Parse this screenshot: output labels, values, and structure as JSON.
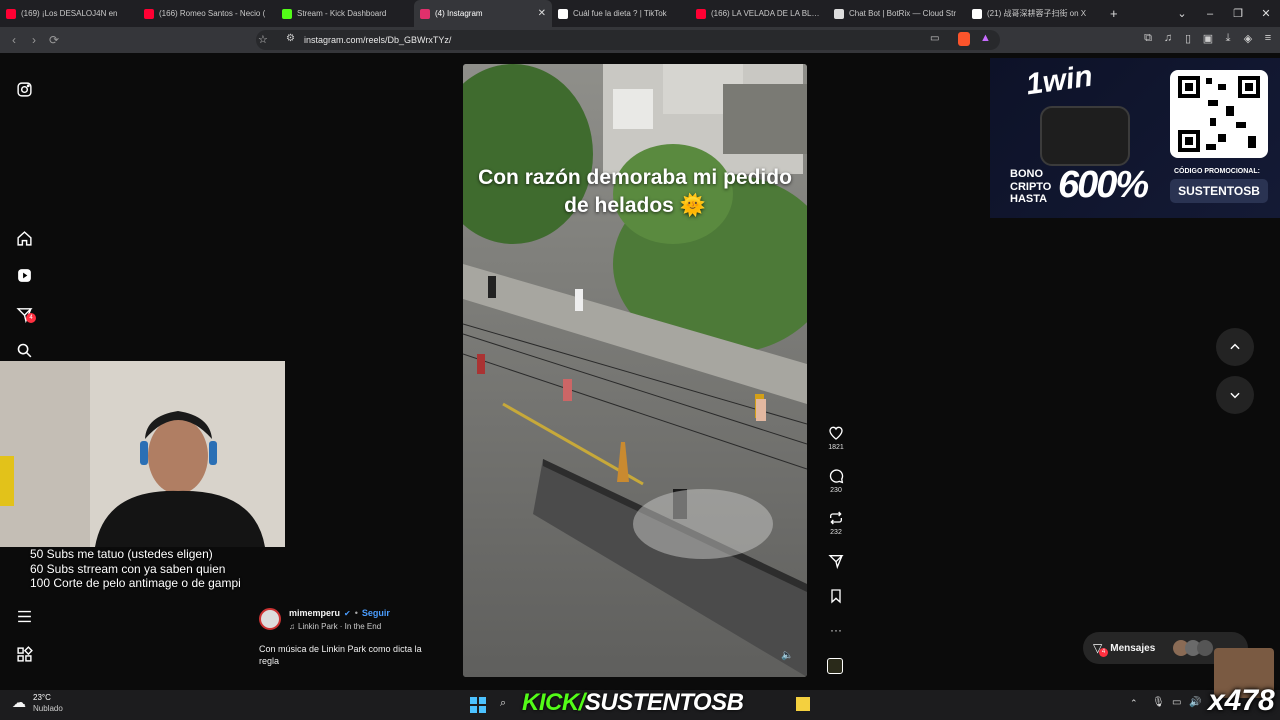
{
  "browser": {
    "tabs": [
      {
        "label": "(169) ¡Los DESALOJ4N en",
        "favicon_color": "#ff0033",
        "active": false
      },
      {
        "label": "(166) Romeo Santos - Necio (",
        "favicon_color": "#ff0033",
        "active": false
      },
      {
        "label": "Stream - Kick Dashboard",
        "favicon_color": "#53fc18",
        "active": false
      },
      {
        "label": "(4) Instagram",
        "favicon_color": "#e1306c",
        "active": true
      },
      {
        "label": "Cuál fue la dieta ? | TikTok",
        "favicon_color": "#ffffff",
        "active": false
      },
      {
        "label": "(166) LA VELADA DE LA BLAC",
        "favicon_color": "#ff0033",
        "active": false
      },
      {
        "label": "Chat Bot | BotRix — Cloud Str",
        "favicon_color": "#dddddd",
        "active": false
      },
      {
        "label": "(21) 战哥深耕蓉子扫街 on X",
        "favicon_color": "#ffffff",
        "active": false
      }
    ],
    "url": "instagram.com/reels/Db_GBWrxTYz/"
  },
  "reel": {
    "caption": "Con razón demoraba mi pedido de helados 🌞",
    "likes": "1821",
    "comments": "230",
    "reposts": "232",
    "author": {
      "username": "mimemperu",
      "follow_label": "Seguir",
      "audio": "Linkin Park · In the End"
    },
    "description": "Con música de Linkin Park como dicta la regla"
  },
  "sidebar": {
    "notification_count": "4"
  },
  "stream_overlay": {
    "goals": [
      "50 Subs me tatuo (ustedes eligen)",
      "60 Subs strream con ya saben quien",
      "100 Corte de pelo antimage o de gampi"
    ],
    "kick_banner_prefix": "KICK/",
    "kick_banner_name": "SUSTENTOSB",
    "multiplier": "x478"
  },
  "ad": {
    "brand": "1win",
    "bono_lines": [
      "BONO",
      "CRIPTO",
      "HASTA"
    ],
    "percent": "600%",
    "promo_label": "CÓDIGO PROMOCIONAL:",
    "promo_code": "SUSTENTOSB"
  },
  "messages": {
    "label": "Mensajes",
    "count": "4"
  },
  "taskbar": {
    "temperature": "23°C",
    "weather": "Nublado"
  },
  "colors": {
    "kick_green": "#53fc18",
    "instagram_blue": "#4a9dff",
    "badge_red": "#ff3040"
  }
}
